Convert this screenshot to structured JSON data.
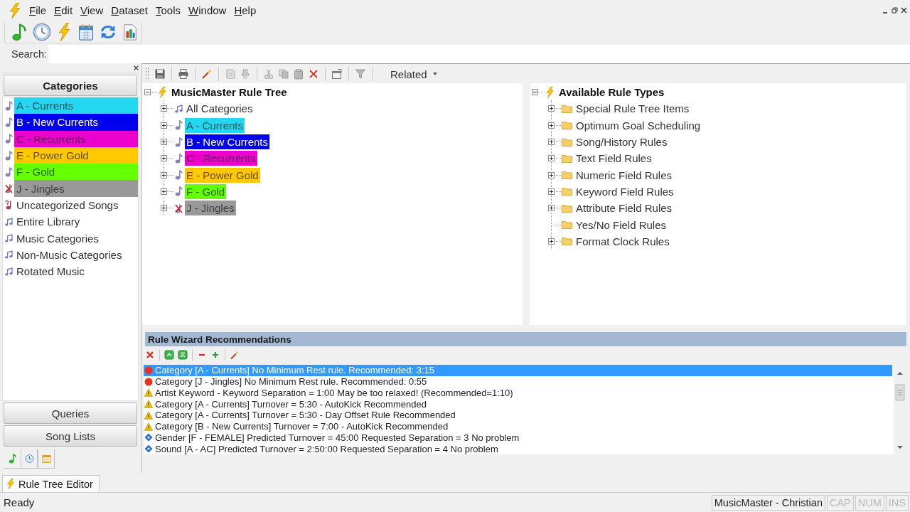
{
  "menu_bar": {
    "items": [
      "File",
      "Edit",
      "View",
      "Dataset",
      "Tools",
      "Window",
      "Help"
    ]
  },
  "search": {
    "label": "Search:"
  },
  "navigator": {
    "sections": [
      {
        "label": "Categories",
        "selected": true
      },
      {
        "label": "Queries",
        "selected": false
      },
      {
        "label": "Song Lists",
        "selected": false
      }
    ],
    "items": [
      {
        "label": "A - Currents",
        "kind": "category",
        "color": "#22d7ef"
      },
      {
        "label": "B - New Currents",
        "kind": "category",
        "color": "#0000ee"
      },
      {
        "label": "C - Recurrents",
        "kind": "category",
        "color": "#ee00cc"
      },
      {
        "label": "E - Power Gold",
        "kind": "category",
        "color": "#ffc800"
      },
      {
        "label": "F - Gold",
        "kind": "category",
        "color": "#66ff00"
      },
      {
        "label": "J - Jingles",
        "kind": "jingle",
        "color": "#999999"
      },
      {
        "label": "Uncategorized Songs",
        "kind": "uncategorized"
      },
      {
        "label": "Entire Library",
        "kind": "group"
      },
      {
        "label": "Music Categories",
        "kind": "group"
      },
      {
        "label": "Non-Music Categories",
        "kind": "group"
      },
      {
        "label": "Rotated Music",
        "kind": "group"
      }
    ],
    "panel_tabs": [
      {
        "kind": "music",
        "selected": true
      },
      {
        "kind": "clock",
        "selected": false
      },
      {
        "kind": "calendar",
        "selected": false
      }
    ]
  },
  "rule_tree_toolbar": {
    "dropdown": "Related"
  },
  "rule_tree": {
    "label": "MusicMaster Rule Tree",
    "expanded": true,
    "children": [
      {
        "label": "All Categories",
        "kind": "group",
        "expanded": false
      },
      {
        "label": "A - Currents",
        "kind": "category",
        "color": "#22d7ef",
        "expanded": false
      },
      {
        "label": "B - New Currents",
        "kind": "category",
        "color": "#0000ee",
        "expanded": false
      },
      {
        "label": "C - Recurrents",
        "kind": "category",
        "color": "#ee00cc",
        "expanded": false
      },
      {
        "label": "E - Power Gold",
        "kind": "category",
        "color": "#ffc800",
        "expanded": false
      },
      {
        "label": "F - Gold",
        "kind": "category",
        "color": "#66ff00",
        "expanded": false
      },
      {
        "label": "J - Jingles",
        "kind": "jingle",
        "color": "#999999",
        "expanded": false
      }
    ]
  },
  "rule_types": {
    "label": "Available Rule Types",
    "expanded": true,
    "children": [
      {
        "label": "Special Rule Tree Items",
        "expanded": false
      },
      {
        "label": "Optimum Goal Scheduling",
        "expanded": false
      },
      {
        "label": "Song/History Rules",
        "expanded": false
      },
      {
        "label": "Text Field Rules",
        "expanded": false
      },
      {
        "label": "Numeric Field Rules",
        "expanded": false
      },
      {
        "label": "Keyword Field Rules",
        "expanded": false
      },
      {
        "label": "Attribute Field Rules",
        "expanded": false
      },
      {
        "label": "Yes/No Field Rules"
      },
      {
        "label": "Format Clock Rules",
        "expanded": false
      }
    ]
  },
  "recommendations": {
    "title": "Rule Wizard Recommendations",
    "rows": [
      {
        "kind": "error",
        "text": "Category [A - Currents] No Minimum Rest rule. Recommended: 3:15",
        "selected": true
      },
      {
        "kind": "error",
        "text": "Category [J - Jingles] No Minimum Rest rule. Recommended: 0:55",
        "selected": false
      },
      {
        "kind": "warning",
        "text": "Artist Keyword - Keyword Separation = 1:00 May be too relaxed! (Recommended=1:10)",
        "selected": false
      },
      {
        "kind": "warning",
        "text": "Category [A - Currents] Turnover = 5:30 - AutoKick Recommended",
        "selected": false
      },
      {
        "kind": "warning",
        "text": "Category [A - Currents] Turnover = 5:30 - Day Offset Rule Recommended",
        "selected": false
      },
      {
        "kind": "warning",
        "text": "Category [B - New Currents] Turnover = 7:00 - AutoKick Recommended",
        "selected": false
      },
      {
        "kind": "info",
        "text": "Gender [F - FEMALE] Predicted Turnover = 45:00 Requested Separation = 3 No problem",
        "selected": false
      },
      {
        "kind": "info",
        "text": "Sound [A - AC] Predicted Turnover = 2:50:00 Requested Separation = 4 No problem",
        "selected": false
      }
    ]
  },
  "document_tabs": [
    {
      "label": "Rule Tree Editor",
      "selected": true
    }
  ],
  "status_bar": {
    "message": "Ready",
    "user": "MusicMaster - Christian",
    "indicators": [
      {
        "label": "CAP",
        "on": false
      },
      {
        "label": "NUM",
        "on": false
      },
      {
        "label": "INS",
        "on": false
      }
    ]
  }
}
